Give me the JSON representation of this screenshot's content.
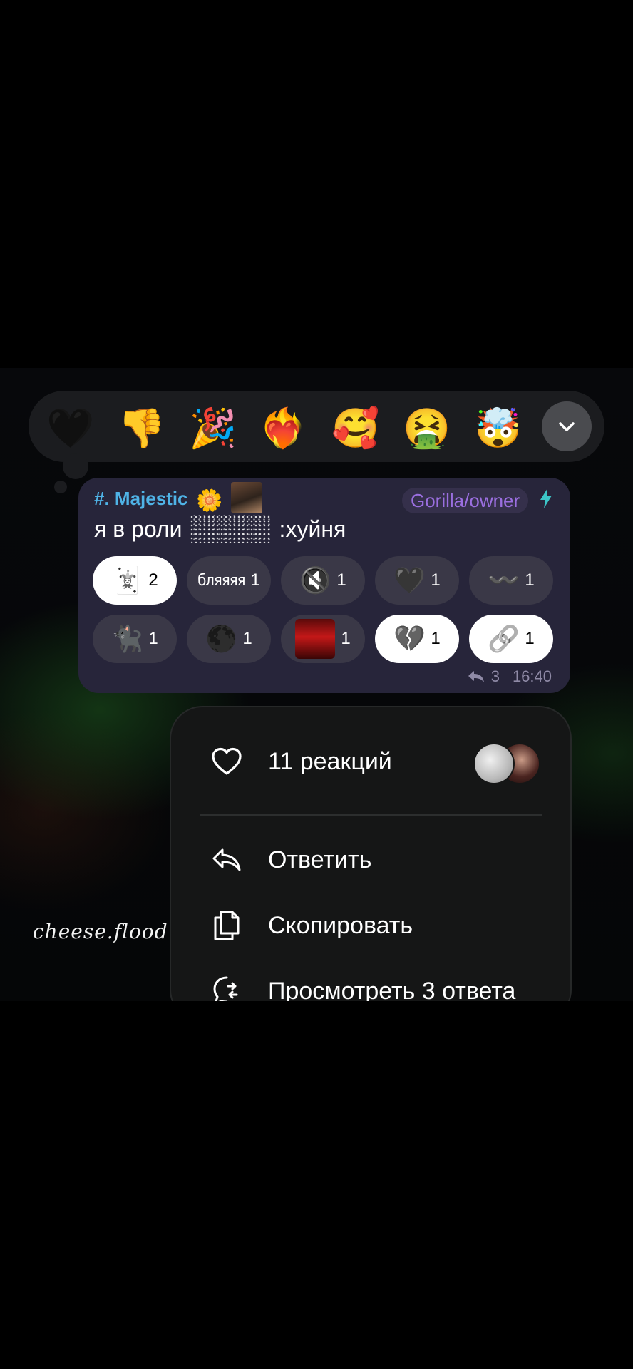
{
  "picker": {
    "emojis": [
      "🖤",
      "👎",
      "🎉",
      "❤️‍🔥",
      "🥰",
      "🤮",
      "🤯"
    ],
    "expand_icon": "chevron-down-icon"
  },
  "message": {
    "sender": "#. Majestic",
    "sender_badge": "🌼",
    "tag": "Gorilla/owner",
    "text_before": "я в роли",
    "text_after": ":хуйня",
    "reactions": [
      {
        "emoji": "🃏",
        "count": "2",
        "active": true
      },
      {
        "text": "бляяяя",
        "count": "1",
        "active": false
      },
      {
        "emoji": "🔇",
        "count": "1",
        "active": false
      },
      {
        "emoji": "🖤",
        "count": "1",
        "active": false
      },
      {
        "emoji": "〰️",
        "count": "1",
        "active": false
      },
      {
        "emoji": "🐈‍⬛",
        "count": "1",
        "active": false
      },
      {
        "emoji": "🌑",
        "count": "1",
        "active": false
      },
      {
        "thumb": "red-room-thumbnail",
        "count": "1",
        "active": false
      },
      {
        "emoji": "💔",
        "count": "1",
        "active": true
      },
      {
        "emoji": "🔗",
        "count": "1",
        "active": true
      }
    ],
    "reply_count": "3",
    "time": "16:40"
  },
  "menu": {
    "reactions_label": "11 реакций",
    "reply_label": "Ответить",
    "copy_label": "Скопировать",
    "view_replies_label": "Просмотреть 3 ответа"
  },
  "watermark": "cheese.flood",
  "colors": {
    "bubble": "#27253a",
    "sender": "#4fb3e6",
    "tag": "#9b6fe0",
    "menu_bg": "#151616",
    "reaction_bg": "#3a3847"
  }
}
